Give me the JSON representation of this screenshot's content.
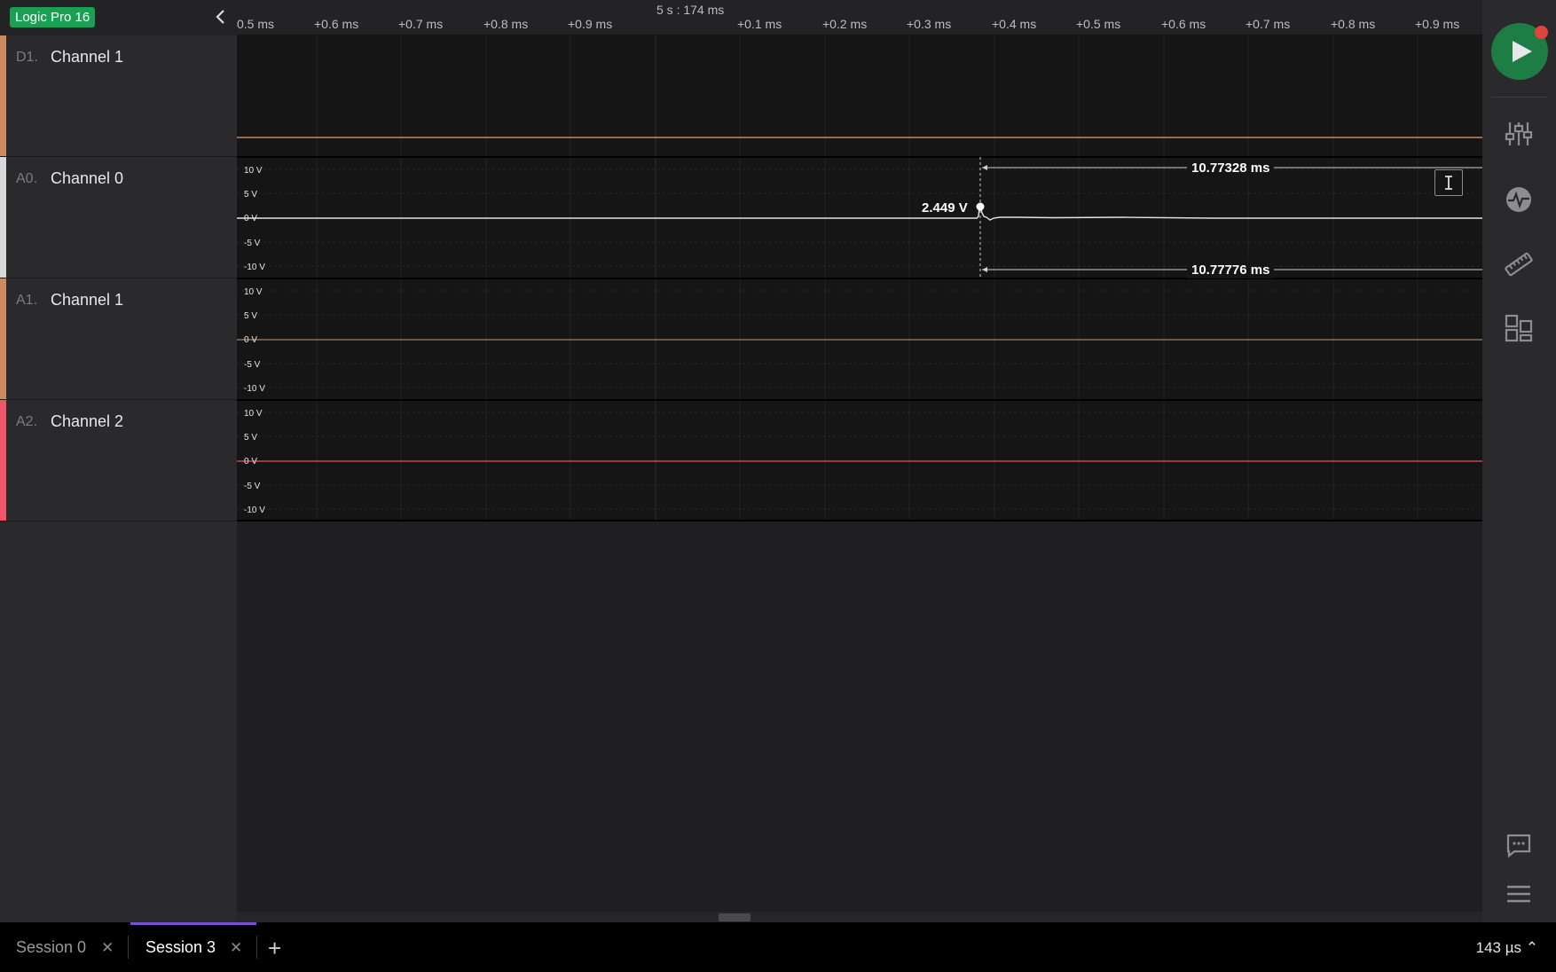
{
  "device": {
    "name": "Logic Pro 16"
  },
  "channels": [
    {
      "prefix": "D1.",
      "name": "Channel 1",
      "color": "#cc8a5e"
    },
    {
      "prefix": "A0.",
      "name": "Channel 0",
      "color": "#d9d9d9"
    },
    {
      "prefix": "A1.",
      "name": "Channel 1",
      "color": "#cc8a5e"
    },
    {
      "prefix": "A2.",
      "name": "Channel 2",
      "color": "#f0566a"
    }
  ],
  "timeline": {
    "center_label": "5 s : 174 ms",
    "ticks": [
      "0.5 ms",
      "+0.6 ms",
      "+0.7 ms",
      "+0.8 ms",
      "+0.9 ms",
      "+0.1 ms",
      "+0.2 ms",
      "+0.3 ms",
      "+0.4 ms",
      "+0.5 ms",
      "+0.6 ms",
      "+0.7 ms",
      "+0.8 ms",
      "+0.9 ms"
    ]
  },
  "voltage_labels": [
    "10 V",
    "5 V",
    "0 V",
    "-5 V",
    "-10 V"
  ],
  "measurements": {
    "cursor_value": "2.449 V",
    "top_duration": "10.77328 ms",
    "bottom_duration": "10.77776 ms"
  },
  "tabs": [
    {
      "label": "Session 0",
      "active": false
    },
    {
      "label": "Session 3",
      "active": true
    }
  ],
  "status": {
    "zoom": "143 µs ⌃"
  },
  "icons": [
    "collapse-chevron-icon",
    "play-icon",
    "sliders-icon",
    "analyzer-icon",
    "ruler-icon",
    "extensions-icon",
    "chat-icon",
    "menu-icon",
    "text-cursor-icon",
    "close-icon",
    "plus-icon"
  ]
}
